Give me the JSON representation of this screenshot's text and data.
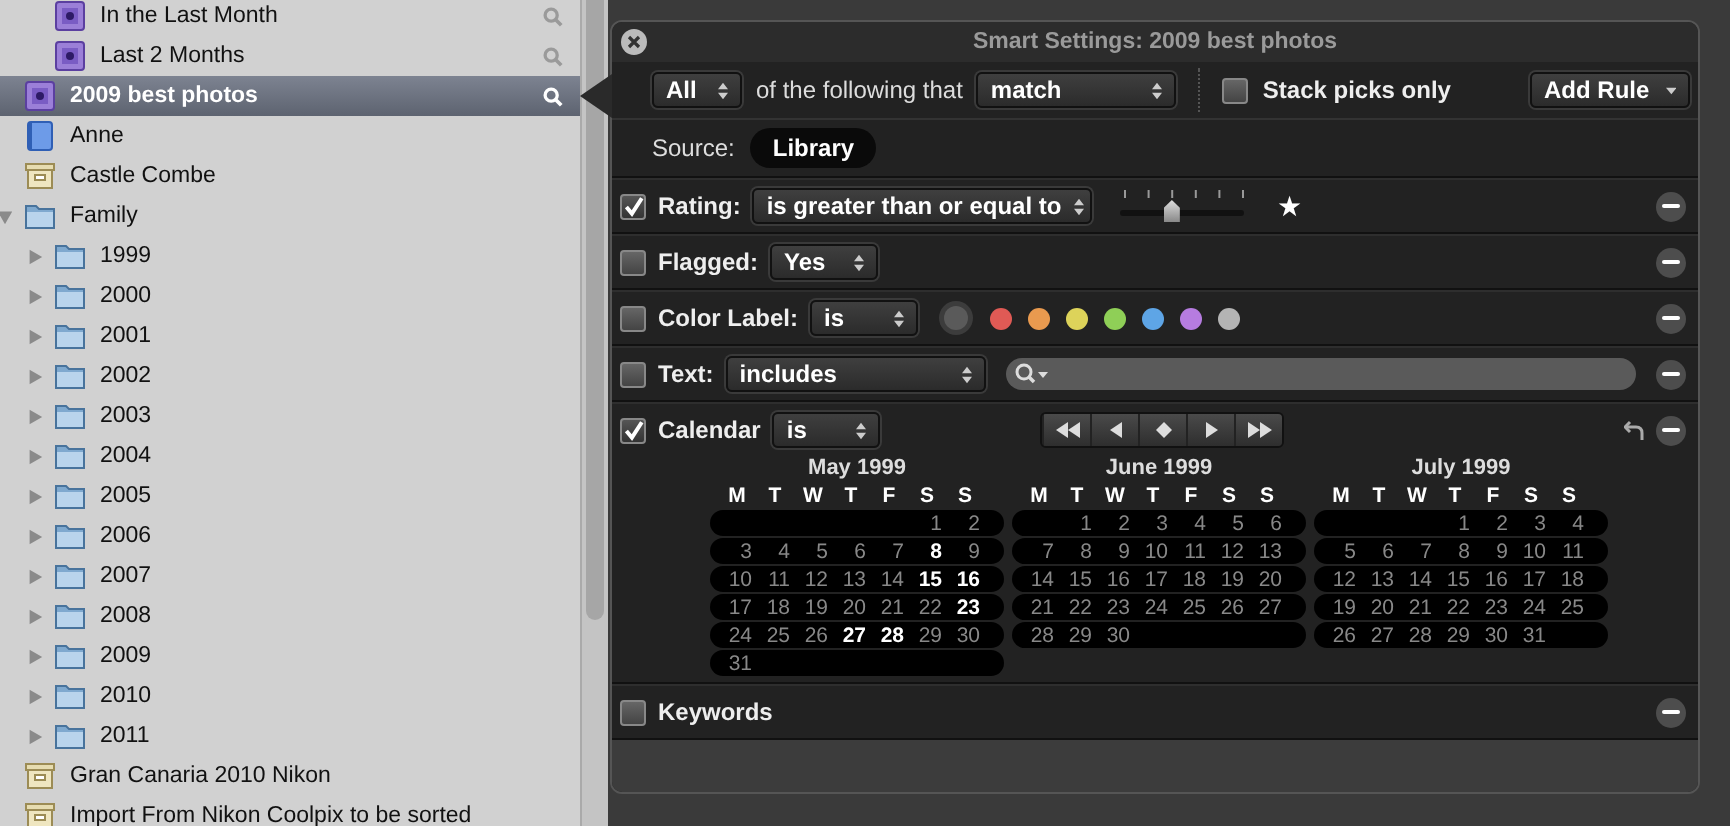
{
  "sidebar": {
    "items": [
      {
        "children": [
          {
            "label": "In the Last Month",
            "kind": "smart_album",
            "selected": false
          },
          {
            "label": "Last 2 Months",
            "kind": "smart_album",
            "selected": false
          }
        ]
      },
      {
        "label": "2009 best photos",
        "kind": "smart_album",
        "selected": true
      },
      {
        "label": "Anne",
        "kind": "album",
        "selected": false
      },
      {
        "label": "Castle Combe",
        "kind": "project",
        "selected": false
      },
      {
        "label": "Family",
        "kind": "folder",
        "selected": false,
        "expanded": true,
        "children": [
          {
            "label": "1999",
            "kind": "folder",
            "selected": false,
            "expanded": false
          },
          {
            "label": "2000",
            "kind": "folder",
            "selected": false,
            "expanded": false
          },
          {
            "label": "2001",
            "kind": "folder",
            "selected": false,
            "expanded": false
          },
          {
            "label": "2002",
            "kind": "folder",
            "selected": false,
            "expanded": false
          },
          {
            "label": "2003",
            "kind": "folder",
            "selected": false,
            "expanded": false
          },
          {
            "label": "2004",
            "kind": "folder",
            "selected": false,
            "expanded": false
          },
          {
            "label": "2005",
            "kind": "folder",
            "selected": false,
            "expanded": false
          },
          {
            "label": "2006",
            "kind": "folder",
            "selected": false,
            "expanded": false
          },
          {
            "label": "2007",
            "kind": "folder",
            "selected": false,
            "expanded": false
          },
          {
            "label": "2008",
            "kind": "folder",
            "selected": false,
            "expanded": false
          },
          {
            "label": "2009",
            "kind": "folder",
            "selected": false,
            "expanded": false
          },
          {
            "label": "2010",
            "kind": "folder",
            "selected": false,
            "expanded": false
          },
          {
            "label": "2011",
            "kind": "folder",
            "selected": false,
            "expanded": false
          }
        ]
      },
      {
        "label": "Gran Canaria 2010 Nikon",
        "kind": "project",
        "selected": false
      },
      {
        "label": "Import From Nikon Coolpix to be sorted",
        "kind": "project",
        "selected": false
      }
    ]
  },
  "smart_settings": {
    "title": "Smart Settings: 2009 best photos",
    "match_scope": "All",
    "match_text": "of the following that",
    "match_mode": "match",
    "stack_picks_only": {
      "label": "Stack picks only",
      "checked": false
    },
    "add_rule": "Add Rule",
    "source_label": "Source:",
    "source": "Library",
    "rules": [
      {
        "kind": "rating",
        "checked": true,
        "label": "Rating:",
        "operator": "is greater than or equal to",
        "level": 0.4,
        "star": "★"
      },
      {
        "kind": "flagged",
        "checked": false,
        "label": "Flagged:",
        "operator": "Yes"
      },
      {
        "kind": "color_label",
        "checked": false,
        "label": "Color Label:",
        "operator": "is",
        "colors": [
          {
            "color": "#e05a55"
          },
          {
            "color": "#e99a4f"
          },
          {
            "color": "#ddd35a"
          },
          {
            "color": "#8fcf57"
          },
          {
            "color": "#5ea5e6"
          },
          {
            "color": "#b67ce0"
          },
          {
            "color": "#b4b4b4"
          }
        ]
      },
      {
        "kind": "text",
        "checked": false,
        "label": "Text:",
        "operator": "includes"
      },
      {
        "kind": "calendar",
        "checked": true,
        "label": "Calendar",
        "operator": "is",
        "months": [
          {
            "title": "May 1999",
            "weekdays": [
              "M",
              "T",
              "W",
              "T",
              "F",
              "S",
              "S"
            ],
            "weeks": [
              [
                {
                  "day": "1",
                  "highlighted": false
                },
                {
                  "day": "2",
                  "highlighted": false
                }
              ],
              [
                {
                  "day": "3",
                  "highlighted": false
                },
                {
                  "day": "4",
                  "highlighted": false
                },
                {
                  "day": "5",
                  "highlighted": false
                },
                {
                  "day": "6",
                  "highlighted": false
                },
                {
                  "day": "7",
                  "highlighted": false
                },
                {
                  "day": "8",
                  "highlighted": true
                },
                {
                  "day": "9",
                  "highlighted": false
                }
              ],
              [
                {
                  "day": "10",
                  "highlighted": false
                },
                {
                  "day": "11",
                  "highlighted": false
                },
                {
                  "day": "12",
                  "highlighted": false
                },
                {
                  "day": "13",
                  "highlighted": false
                },
                {
                  "day": "14",
                  "highlighted": false
                },
                {
                  "day": "15",
                  "highlighted": true
                },
                {
                  "day": "16",
                  "highlighted": true
                }
              ],
              [
                {
                  "day": "17",
                  "highlighted": false
                },
                {
                  "day": "18",
                  "highlighted": false
                },
                {
                  "day": "19",
                  "highlighted": false
                },
                {
                  "day": "20",
                  "highlighted": false
                },
                {
                  "day": "21",
                  "highlighted": false
                },
                {
                  "day": "22",
                  "highlighted": false
                },
                {
                  "day": "23",
                  "highlighted": true
                }
              ],
              [
                {
                  "day": "24",
                  "highlighted": false
                },
                {
                  "day": "25",
                  "highlighted": false
                },
                {
                  "day": "26",
                  "highlighted": false
                },
                {
                  "day": "27",
                  "highlighted": true
                },
                {
                  "day": "28",
                  "highlighted": true
                },
                {
                  "day": "29",
                  "highlighted": false
                },
                {
                  "day": "30",
                  "highlighted": false
                }
              ],
              [
                {
                  "day": "31",
                  "highlighted": false
                }
              ]
            ]
          },
          {
            "title": "June 1999",
            "weekdays": [
              "M",
              "T",
              "W",
              "T",
              "F",
              "S",
              "S"
            ],
            "weeks": [
              [
                {
                  "day": "1",
                  "highlighted": false
                },
                {
                  "day": "2",
                  "highlighted": false
                },
                {
                  "day": "3",
                  "highlighted": false
                },
                {
                  "day": "4",
                  "highlighted": false
                },
                {
                  "day": "5",
                  "highlighted": false
                },
                {
                  "day": "6",
                  "highlighted": false
                }
              ],
              [
                {
                  "day": "7",
                  "highlighted": false
                },
                {
                  "day": "8",
                  "highlighted": false
                },
                {
                  "day": "9",
                  "highlighted": false
                },
                {
                  "day": "10",
                  "highlighted": false
                },
                {
                  "day": "11",
                  "highlighted": false
                },
                {
                  "day": "12",
                  "highlighted": false
                },
                {
                  "day": "13",
                  "highlighted": false
                }
              ],
              [
                {
                  "day": "14",
                  "highlighted": false
                },
                {
                  "day": "15",
                  "highlighted": false
                },
                {
                  "day": "16",
                  "highlighted": false
                },
                {
                  "day": "17",
                  "highlighted": false
                },
                {
                  "day": "18",
                  "highlighted": false
                },
                {
                  "day": "19",
                  "highlighted": false
                },
                {
                  "day": "20",
                  "highlighted": false
                }
              ],
              [
                {
                  "day": "21",
                  "highlighted": false
                },
                {
                  "day": "22",
                  "highlighted": false
                },
                {
                  "day": "23",
                  "highlighted": false
                },
                {
                  "day": "24",
                  "highlighted": false
                },
                {
                  "day": "25",
                  "highlighted": false
                },
                {
                  "day": "26",
                  "highlighted": false
                },
                {
                  "day": "27",
                  "highlighted": false
                }
              ],
              [
                {
                  "day": "28",
                  "highlighted": false
                },
                {
                  "day": "29",
                  "highlighted": false
                },
                {
                  "day": "30",
                  "highlighted": false
                }
              ]
            ]
          },
          {
            "title": "July 1999",
            "weekdays": [
              "M",
              "T",
              "W",
              "T",
              "F",
              "S",
              "S"
            ],
            "weeks": [
              [
                {
                  "day": "1",
                  "highlighted": false
                },
                {
                  "day": "2",
                  "highlighted": false
                },
                {
                  "day": "3",
                  "highlighted": false
                },
                {
                  "day": "4",
                  "highlighted": false
                }
              ],
              [
                {
                  "day": "5",
                  "highlighted": false
                },
                {
                  "day": "6",
                  "highlighted": false
                },
                {
                  "day": "7",
                  "highlighted": false
                },
                {
                  "day": "8",
                  "highlighted": false
                },
                {
                  "day": "9",
                  "highlighted": false
                },
                {
                  "day": "10",
                  "highlighted": false
                },
                {
                  "day": "11",
                  "highlighted": false
                }
              ],
              [
                {
                  "day": "12",
                  "highlighted": false
                },
                {
                  "day": "13",
                  "highlighted": false
                },
                {
                  "day": "14",
                  "highlighted": false
                },
                {
                  "day": "15",
                  "highlighted": false
                },
                {
                  "day": "16",
                  "highlighted": false
                },
                {
                  "day": "17",
                  "highlighted": false
                },
                {
                  "day": "18",
                  "highlighted": false
                }
              ],
              [
                {
                  "day": "19",
                  "highlighted": false
                },
                {
                  "day": "20",
                  "highlighted": false
                },
                {
                  "day": "21",
                  "highlighted": false
                },
                {
                  "day": "22",
                  "highlighted": false
                },
                {
                  "day": "23",
                  "highlighted": false
                },
                {
                  "day": "24",
                  "highlighted": false
                },
                {
                  "day": "25",
                  "highlighted": false
                }
              ],
              [
                {
                  "day": "26",
                  "highlighted": false
                },
                {
                  "day": "27",
                  "highlighted": false
                },
                {
                  "day": "28",
                  "highlighted": false
                },
                {
                  "day": "29",
                  "highlighted": false
                },
                {
                  "day": "30",
                  "highlighted": false
                },
                {
                  "day": "31",
                  "highlighted": false
                }
              ]
            ]
          }
        ]
      },
      {
        "kind": "keywords",
        "checked": false,
        "label": "Keywords"
      }
    ]
  }
}
